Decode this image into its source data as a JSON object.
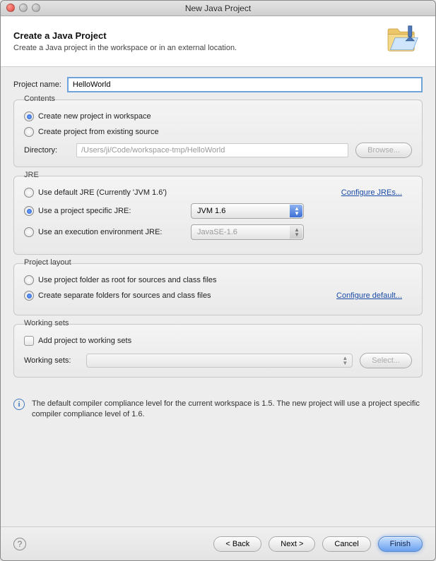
{
  "window": {
    "title": "New Java Project"
  },
  "banner": {
    "heading": "Create a Java Project",
    "sub": "Create a Java project in the workspace or in an external location."
  },
  "project": {
    "name_label": "Project name:",
    "name_value": "HelloWorld"
  },
  "contents": {
    "legend": "Contents",
    "opt_new": "Create new project in workspace",
    "opt_existing": "Create project from existing source",
    "dir_label": "Directory:",
    "dir_value": "/Users/ji/Code/workspace-tmp/HelloWorld",
    "browse": "Browse..."
  },
  "jre": {
    "legend": "JRE",
    "opt_default": "Use default JRE (Currently 'JVM 1.6')",
    "opt_specific": "Use a project specific JRE:",
    "opt_env": "Use an execution environment JRE:",
    "sel_specific": "JVM 1.6",
    "sel_env": "JavaSE-1.6",
    "configure": "Configure JREs..."
  },
  "layout": {
    "legend": "Project layout",
    "opt_root": "Use project folder as root for sources and class files",
    "opt_sep": "Create separate folders for sources and class files",
    "configure": "Configure default..."
  },
  "ws": {
    "legend": "Working sets",
    "check_label": "Add project to working sets",
    "sets_label": "Working sets:",
    "select": "Select..."
  },
  "info": "The default compiler compliance level for the current workspace is 1.5. The new project will use a project specific compiler compliance level of 1.6.",
  "footer": {
    "back": "< Back",
    "next": "Next >",
    "cancel": "Cancel",
    "finish": "Finish"
  }
}
